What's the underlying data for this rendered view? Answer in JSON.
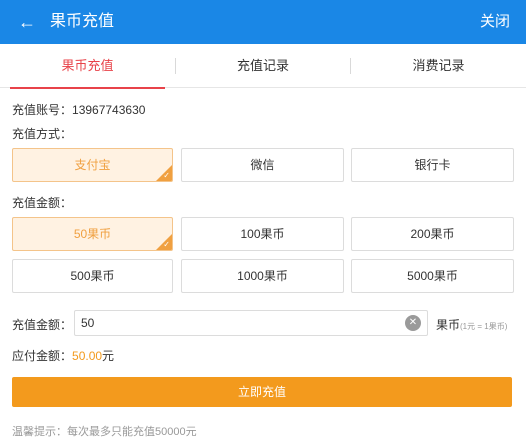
{
  "header": {
    "back_icon": "←",
    "title": "果币充值",
    "close_label": "关闭",
    "bg_color": "#1a87e6"
  },
  "tabs": [
    {
      "label": "果币充值",
      "active": true
    },
    {
      "label": "充值记录",
      "active": false
    },
    {
      "label": "消费记录",
      "active": false
    }
  ],
  "account": {
    "label": "充值账号：",
    "value": "13967743630"
  },
  "payment": {
    "label": "充值方式：",
    "options": [
      {
        "label": "支付宝",
        "selected": true
      },
      {
        "label": "微信",
        "selected": false
      },
      {
        "label": "银行卡",
        "selected": false
      }
    ]
  },
  "amounts": {
    "label": "充值金额：",
    "options": [
      {
        "label": "50果币",
        "selected": true
      },
      {
        "label": "100果币",
        "selected": false
      },
      {
        "label": "200果币",
        "selected": false
      },
      {
        "label": "500果币",
        "selected": false
      },
      {
        "label": "1000果币",
        "selected": false
      },
      {
        "label": "5000果币",
        "selected": false
      }
    ]
  },
  "custom_amount": {
    "label": "充值金额：",
    "value": "50",
    "unit": "果币",
    "rate_note": "(1元 = 1果币)"
  },
  "payable": {
    "label": "应付金额：",
    "value": "50.00",
    "unit": "元",
    "accent": "#f39a1d"
  },
  "submit_label": "立即充值",
  "tip": "温馨提示：每次最多只能充值50000元"
}
